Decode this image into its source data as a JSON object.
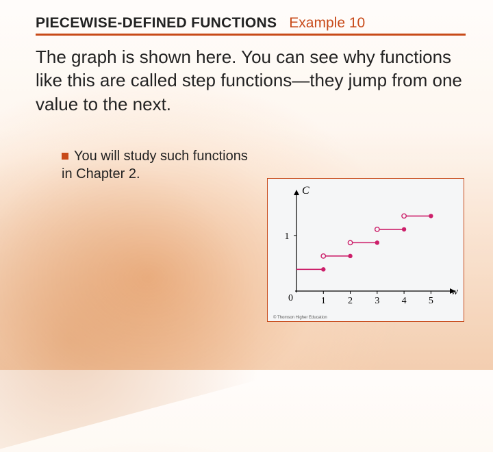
{
  "header": {
    "title": "PIECEWISE-DEFINED FUNCTIONS",
    "example": "Example 10"
  },
  "body": {
    "paragraph": "The graph is shown here. You can see why functions like this are called step functions—they jump from one value to the next.",
    "subpoint": "You will study such functions in Chapter 2."
  },
  "figure": {
    "y_axis_label": "C",
    "x_axis_label": "w",
    "origin_label": "0",
    "y_tick_label": "1",
    "x_tick_labels": [
      "1",
      "2",
      "3",
      "4",
      "5"
    ],
    "copyright": "© Thomson Higher Education"
  },
  "chart_data": {
    "type": "step",
    "title": "",
    "xlabel": "w",
    "ylabel": "C",
    "xlim": [
      0,
      5.5
    ],
    "ylim": [
      0,
      1.7
    ],
    "x_ticks": [
      1,
      2,
      3,
      4,
      5
    ],
    "y_ticks": [
      1
    ],
    "segments": [
      {
        "x_start": 0,
        "x_end": 1,
        "y": 0.39,
        "left_open": false,
        "right_closed": true
      },
      {
        "x_start": 1,
        "x_end": 2,
        "y": 0.63,
        "left_open": true,
        "right_closed": true
      },
      {
        "x_start": 2,
        "x_end": 3,
        "y": 0.87,
        "left_open": true,
        "right_closed": true
      },
      {
        "x_start": 3,
        "x_end": 4,
        "y": 1.11,
        "left_open": true,
        "right_closed": true
      },
      {
        "x_start": 4,
        "x_end": 5,
        "y": 1.35,
        "left_open": true,
        "right_closed": true
      }
    ]
  }
}
